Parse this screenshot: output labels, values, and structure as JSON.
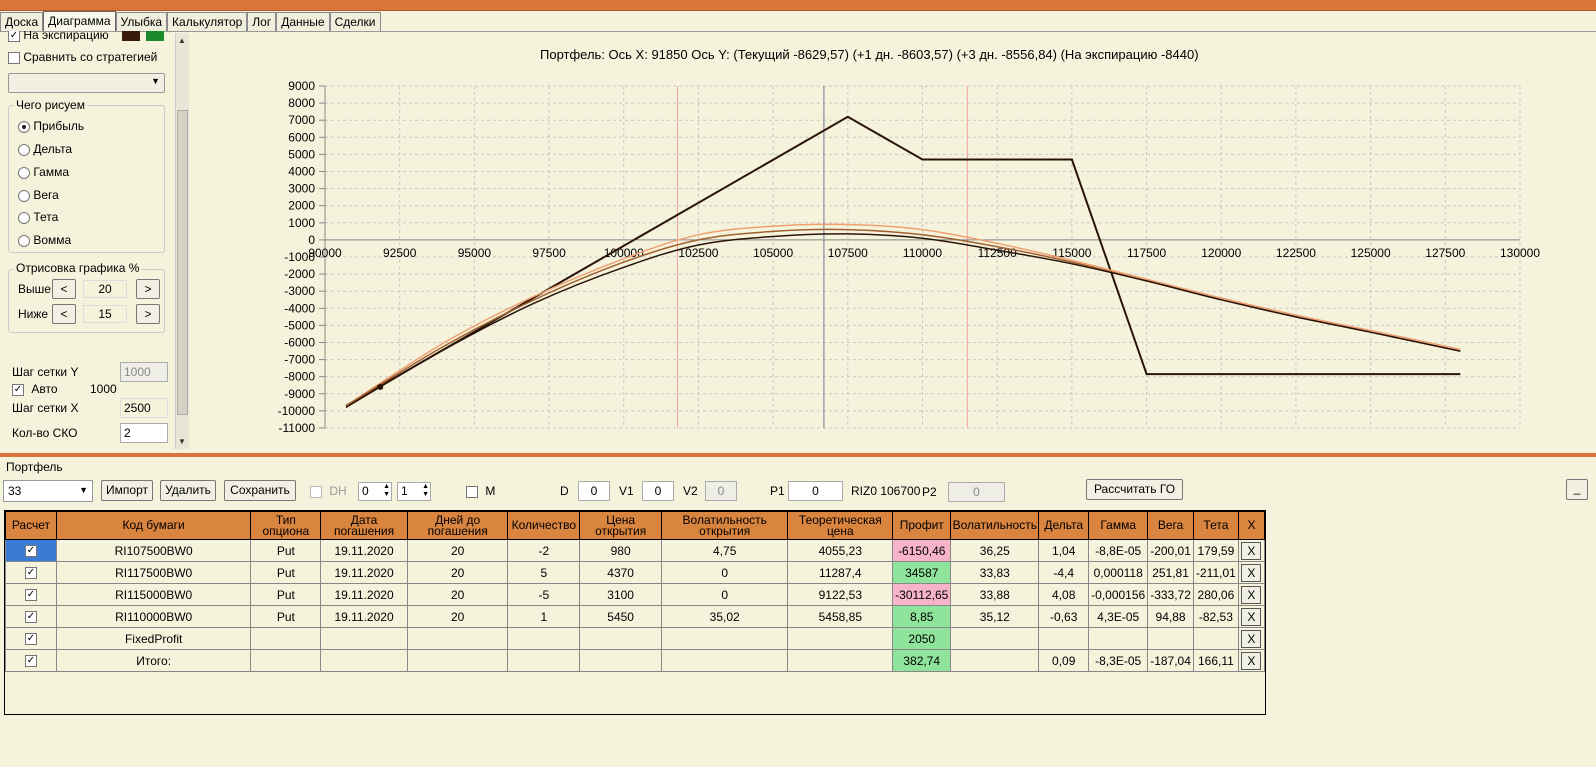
{
  "tabs": [
    "Доска",
    "Диаграмма",
    "Улыбка",
    "Калькулятор",
    "Лог",
    "Данные",
    "Сделки"
  ],
  "left": {
    "at_expiry_label": "На экспирацию",
    "compare_label": "Сравнить со стратегией",
    "draw_group": "Чего рисуем",
    "radios": [
      "Прибыль",
      "Дельта",
      "Гамма",
      "Вега",
      "Тета",
      "Вомма"
    ],
    "render_group": "Отрисовка графика %",
    "above_label": "Выше",
    "above_value": "20",
    "below_label": "Ниже",
    "below_value": "15",
    "prev_symbol": "<",
    "next_symbol": ">",
    "grid_y_label": "Шаг сетки Y",
    "grid_y_value": "1000",
    "auto_label": "Авто",
    "auto_value": "1000",
    "grid_x_label": "Шаг сетки X",
    "grid_x_value": "2500",
    "sko_label": "Кол-во СКО",
    "sko_value": "2"
  },
  "chart_data": {
    "type": "line",
    "title": "Портфель: Ось X: 91850 Ось Y:  (Текущий -8629,57)  (+1 дн. -8603,57)  (+3 дн. -8556,84)  (На экспирацию -8440)",
    "xlim": [
      90000,
      130000
    ],
    "ylim": [
      -11000,
      9000
    ],
    "xticks": [
      90000,
      92500,
      95000,
      97500,
      100000,
      102500,
      105000,
      107500,
      110000,
      112500,
      115000,
      117500,
      120000,
      122500,
      125000,
      127500,
      130000
    ],
    "yticks": [
      9000,
      8000,
      7000,
      6000,
      5000,
      4000,
      3000,
      2000,
      1000,
      0,
      -1000,
      -2000,
      -3000,
      -4000,
      -5000,
      -6000,
      -7000,
      -8000,
      -9000,
      -10000,
      -11000
    ],
    "grid": true,
    "vlines": [
      {
        "x": 101800,
        "color": "#f4a0a0"
      },
      {
        "x": 106700,
        "color": "#6a7a9a"
      },
      {
        "x": 111500,
        "color": "#f4a0a0"
      }
    ],
    "series": [
      {
        "color": "#2a1408",
        "x": [
          90700,
          107500,
          110000,
          115000,
          117500,
          128000
        ],
        "y": [
          -9700,
          7200,
          4700,
          4700,
          -7850,
          -7850
        ]
      },
      {
        "color": "#f0a070",
        "x": [
          90700,
          94000,
          97000,
          100000,
          102500,
          105000,
          107500,
          110000,
          112500,
          115000,
          117500,
          120000,
          122500,
          125000,
          128000
        ],
        "y": [
          -9700,
          -6000,
          -3300,
          -1100,
          300,
          800,
          900,
          600,
          -200,
          -1200,
          -2300,
          -3400,
          -4400,
          -5300,
          -6400
        ]
      },
      {
        "color": "#a06030",
        "x": [
          90700,
          94000,
          97000,
          100000,
          102500,
          105000,
          107500,
          110000,
          112500,
          115000,
          117500,
          120000,
          122500,
          125000,
          128000
        ],
        "y": [
          -9700,
          -6200,
          -3500,
          -1300,
          0,
          500,
          600,
          300,
          -400,
          -1300,
          -2400,
          -3500,
          -4500,
          -5400,
          -6500
        ]
      },
      {
        "color": "#2a1408",
        "x": [
          90700,
          94000,
          97000,
          100000,
          102500,
          105000,
          107500,
          110000,
          112500,
          115000,
          117500,
          120000,
          122500,
          125000,
          128000
        ],
        "y": [
          -9800,
          -6400,
          -3700,
          -1600,
          -300,
          200,
          350,
          100,
          -600,
          -1400,
          -2400,
          -3500,
          -4500,
          -5400,
          -6500
        ]
      }
    ]
  },
  "portfolio": {
    "section_label": "Портфель",
    "select_value": "33",
    "import_label": "Импорт",
    "delete_label": "Удалить",
    "save_label": "Сохранить",
    "dh_label": "DH",
    "dh_a": "0",
    "dh_b": "1",
    "m_label": "M",
    "d_label": "D",
    "d_value": "0",
    "v1_label": "V1",
    "v1_value": "0",
    "v2_label": "V2",
    "v2_value": "0",
    "p1_label": "P1",
    "p1_value": "0",
    "riz_label": "RIZ0 106700",
    "p2_label": "P2",
    "p2_value": "0",
    "calc_go_label": "Рассчитать ГО",
    "minimize_label": "_"
  },
  "table": {
    "headers": [
      "Расчет",
      "Код бумаги",
      "Тип опциона",
      "Дата погашения",
      "Дней до погашения",
      "Количество",
      "Цена открытия",
      "Волатильность открытия",
      "Теоретическая цена",
      "Профит",
      "Волатильность",
      "Дельта",
      "Гамма",
      "Вега",
      "Тета",
      "X"
    ],
    "rows": [
      [
        "RI107500BW0",
        "Put",
        "19.11.2020",
        "20",
        "-2",
        "980",
        "4,75",
        "4055,23",
        "-6150,46",
        "36,25",
        "1,04",
        "-8,8E-05",
        "-200,01",
        "179,59"
      ],
      [
        "RI117500BW0",
        "Put",
        "19.11.2020",
        "20",
        "5",
        "4370",
        "0",
        "11287,4",
        "34587",
        "33,83",
        "-4,4",
        "0,000118",
        "251,81",
        "-211,01"
      ],
      [
        "RI115000BW0",
        "Put",
        "19.11.2020",
        "20",
        "-5",
        "3100",
        "0",
        "9122,53",
        "-30112,65",
        "33,88",
        "4,08",
        "-0,000156",
        "-333,72",
        "280,06"
      ],
      [
        "RI110000BW0",
        "Put",
        "19.11.2020",
        "20",
        "1",
        "5450",
        "35,02",
        "5458,85",
        "8,85",
        "35,12",
        "-0,63",
        "4,3E-05",
        "94,88",
        "-82,53"
      ],
      [
        "FixedProfit",
        "",
        "",
        "",
        "",
        "",
        "",
        "",
        "2050",
        "",
        "",
        "",
        "",
        ""
      ],
      [
        "Итого:",
        "",
        "",
        "",
        "",
        "",
        "",
        "",
        "382,74",
        "",
        "0,09",
        "-8,3E-05",
        "-187,04",
        "166,11"
      ]
    ],
    "profit_status": [
      "neg",
      "pos",
      "neg",
      "pos",
      "pos",
      "pos"
    ],
    "x_label": "X",
    "check_mark": "✓"
  }
}
